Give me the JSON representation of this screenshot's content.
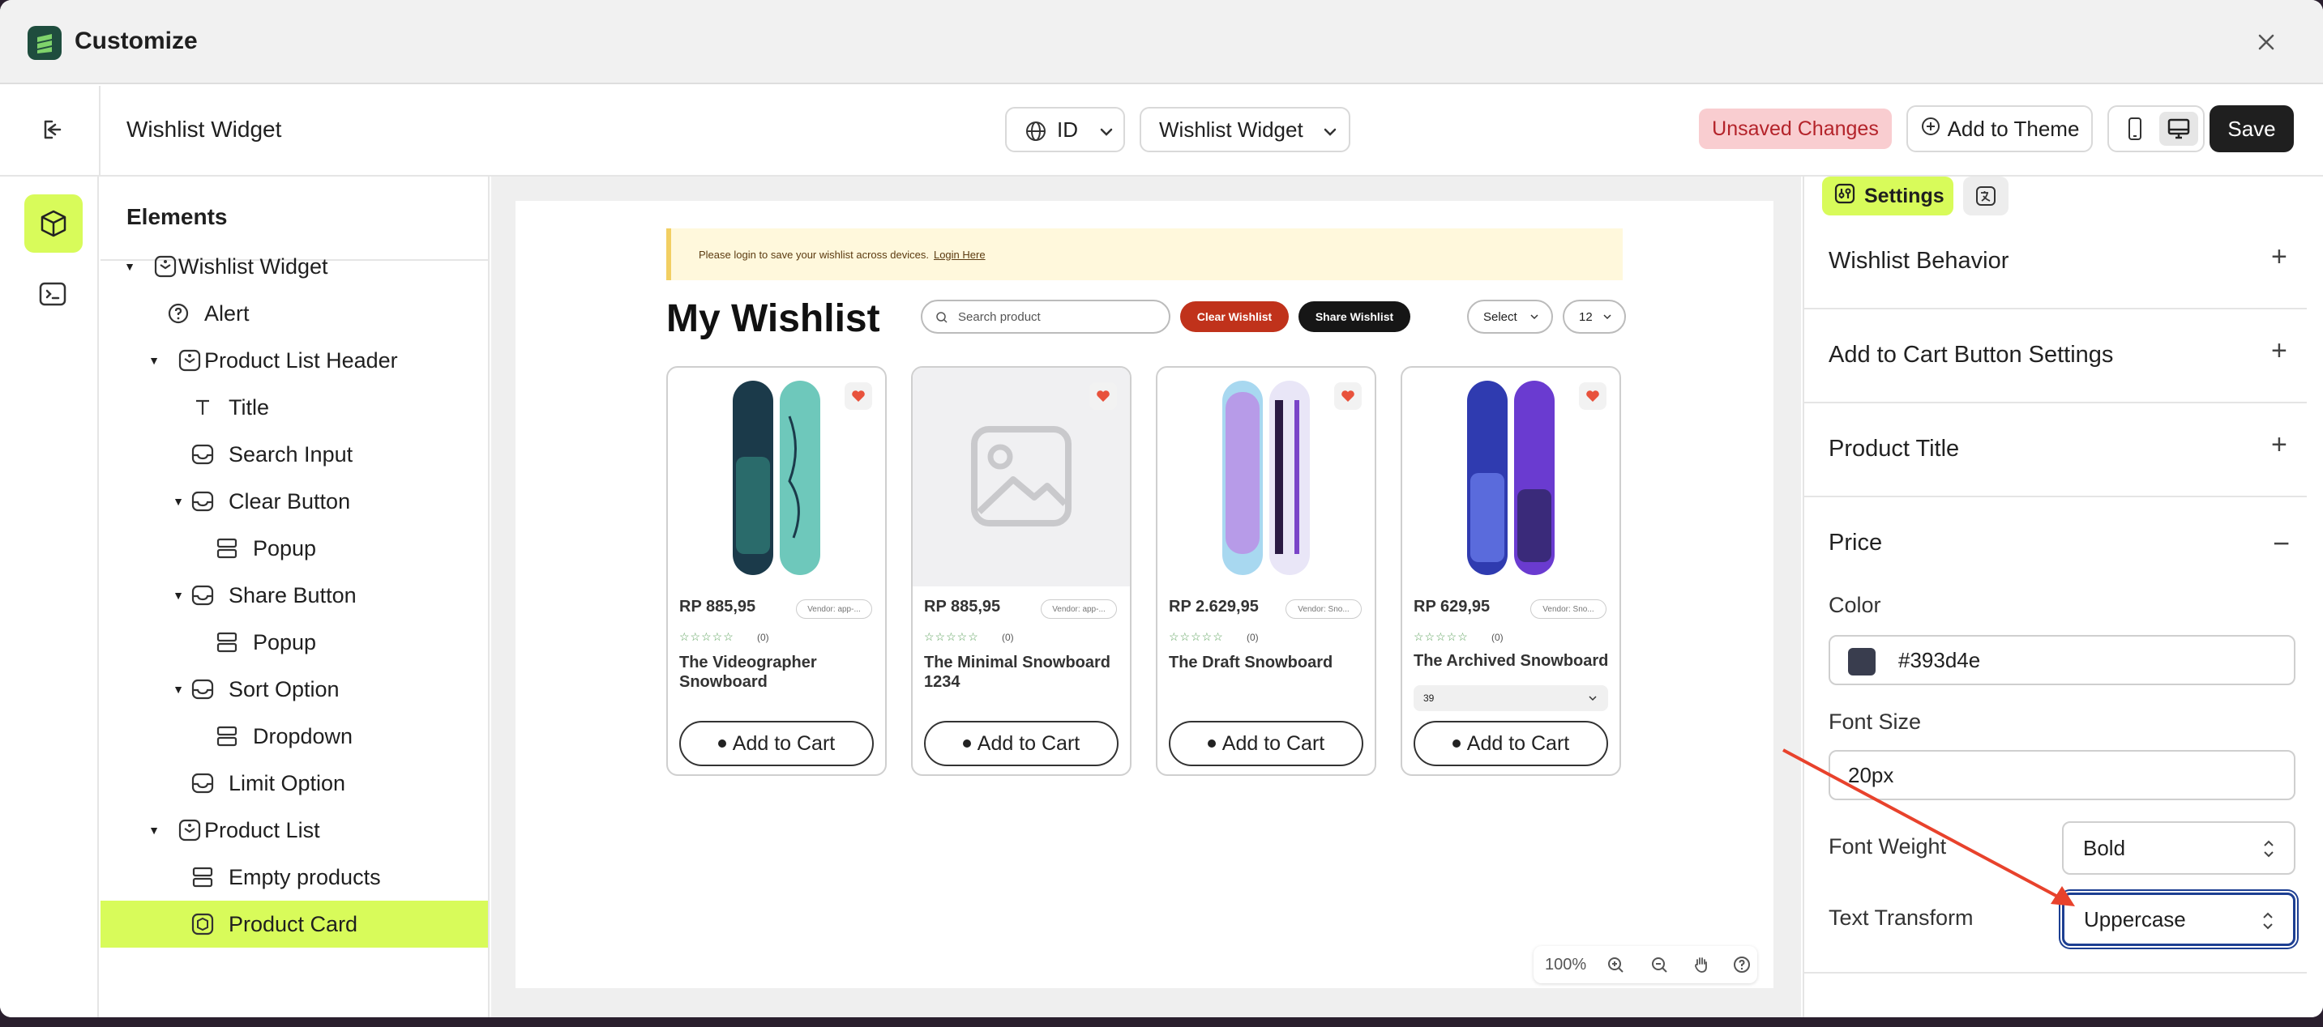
{
  "app": {
    "title": "Customize"
  },
  "topbar": {
    "page_name": "Wishlist Widget",
    "language": "ID",
    "widget": "Wishlist Widget",
    "unsaved": "Unsaved Changes",
    "add_to_theme": "Add to Theme",
    "save": "Save"
  },
  "tree": {
    "heading": "Elements",
    "nodes": [
      {
        "label": "Wishlist Widget",
        "icon": "widget-icon"
      },
      {
        "label": "Alert",
        "icon": "help-circle-icon"
      },
      {
        "label": "Product List Header",
        "icon": "widget-icon"
      },
      {
        "label": "Title",
        "icon": "text-icon"
      },
      {
        "label": "Search Input",
        "icon": "block-icon"
      },
      {
        "label": "Clear Button",
        "icon": "block-icon"
      },
      {
        "label": "Popup",
        "icon": "layout-icon"
      },
      {
        "label": "Share Button",
        "icon": "block-icon"
      },
      {
        "label": "Popup",
        "icon": "layout-icon"
      },
      {
        "label": "Sort Option",
        "icon": "block-icon"
      },
      {
        "label": "Dropdown",
        "icon": "layout-icon"
      },
      {
        "label": "Limit Option",
        "icon": "block-icon"
      },
      {
        "label": "Product List",
        "icon": "widget-icon"
      },
      {
        "label": "Empty products",
        "icon": "layout-icon"
      },
      {
        "label": "Product Card",
        "icon": "card-icon"
      }
    ]
  },
  "preview": {
    "alert_text": "Please login to save your wishlist across devices.",
    "alert_link": "Login Here",
    "title": "My Wishlist",
    "search_placeholder": "Search product",
    "clear_label": "Clear Wishlist",
    "share_label": "Share Wishlist",
    "sort_label": "Select",
    "limit_label": "12",
    "products": [
      {
        "price": "RP 885,95",
        "vendor": "Vendor: app-...",
        "reviews": "(0)",
        "name": "The Videographer Snowboard",
        "cta": "Add to Cart"
      },
      {
        "price": "RP 885,95",
        "vendor": "Vendor: app-...",
        "reviews": "(0)",
        "name": "The Minimal Snowboard 1234",
        "cta": "Add to Cart"
      },
      {
        "price": "RP 2.629,95",
        "vendor": "Vendor: Sno...",
        "reviews": "(0)",
        "name": "The Draft Snowboard",
        "cta": "Add to Cart"
      },
      {
        "price": "RP 629,95",
        "vendor": "Vendor: Sno...",
        "reviews": "(0)",
        "name": "The Archived Snowboard",
        "variant": "39",
        "cta": "Add to Cart"
      }
    ],
    "zoom": "100%"
  },
  "panel": {
    "tab_settings": "Settings",
    "sections": [
      "Wishlist Behavior",
      "Add to Cart Button Settings",
      "Product Title"
    ],
    "price": {
      "heading": "Price",
      "color_label": "Color",
      "color_value": "#393d4e",
      "font_size_label": "Font Size",
      "font_size_value": "20px",
      "font_weight_label": "Font Weight",
      "font_weight_value": "Bold",
      "text_transform_label": "Text Transform",
      "text_transform_value": "Uppercase"
    }
  },
  "colors": {
    "accent": "#d8fb5a",
    "danger": "#c0321b",
    "annotation": "#e8422c"
  }
}
